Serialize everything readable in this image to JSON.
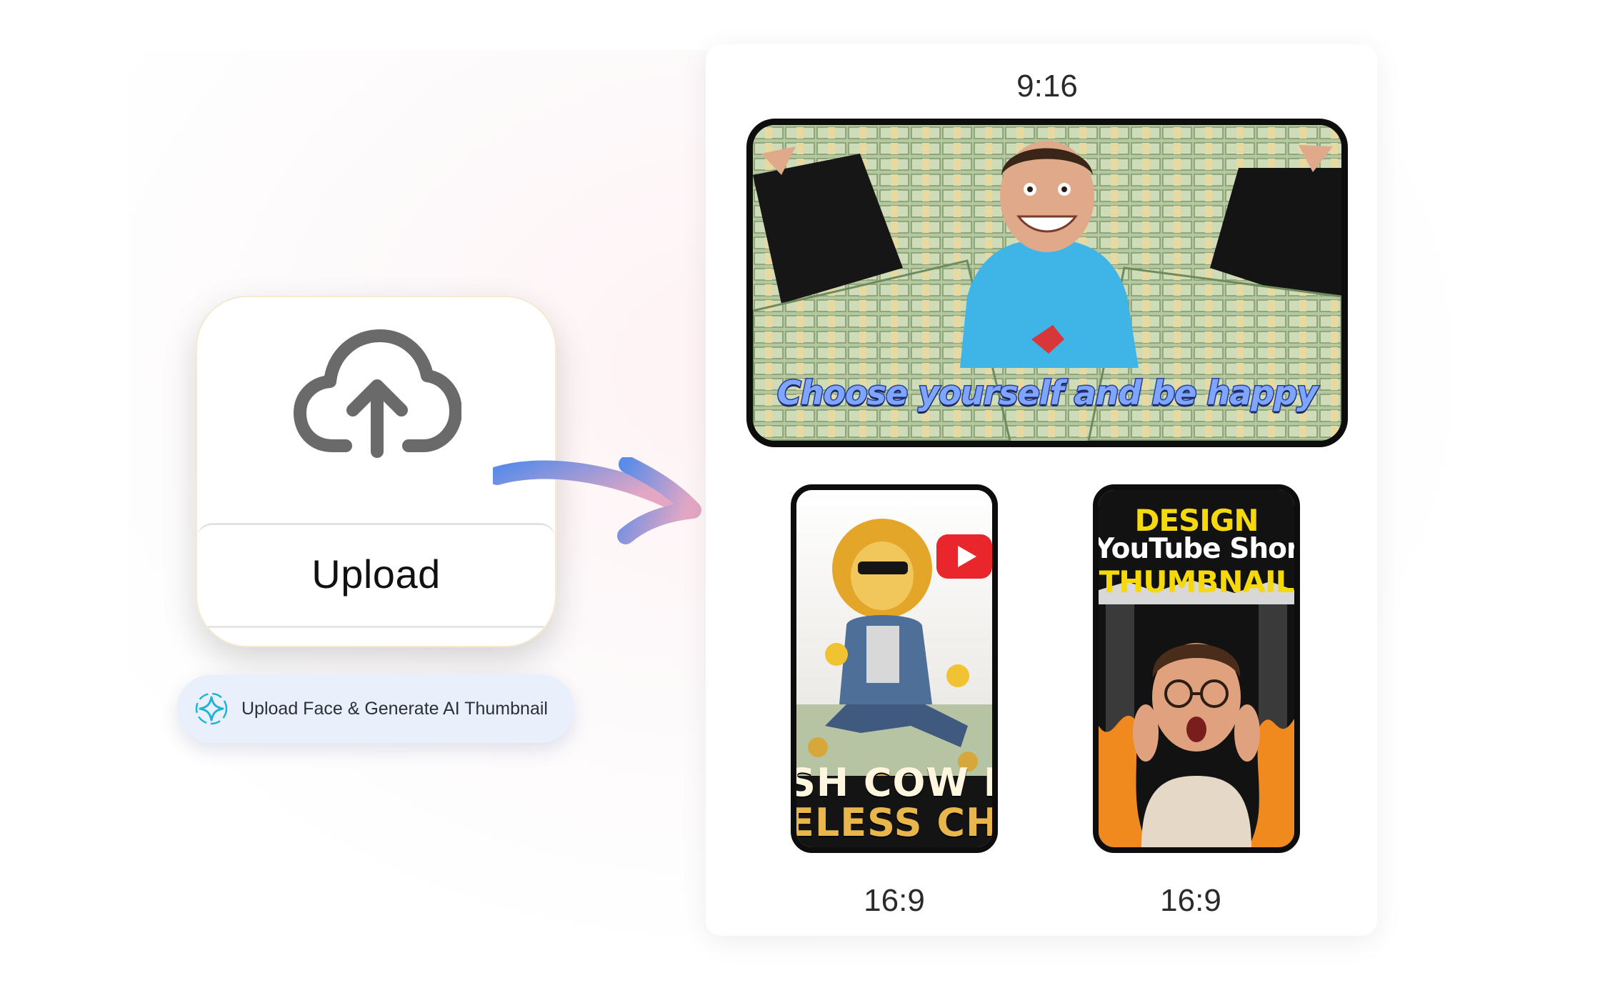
{
  "upload_card": {
    "icon": "cloud-upload-icon",
    "label": "Upload"
  },
  "generate_pill": {
    "icon": "sparkle-icon",
    "label": "Upload Face & Generate AI Thumbnail",
    "accent": "#1fb3d6"
  },
  "flow_arrow": {
    "icon": "curved-arrow-right-icon",
    "gradient": [
      "#5b8ce8",
      "#e3a7c4"
    ]
  },
  "results_panel": {
    "top_ratio": "9:16",
    "thumbnails": [
      {
        "name": "landscape-money",
        "caption": "Choose yourself and be happy"
      },
      {
        "name": "portrait-lion",
        "lines": [
          "SH COW DI",
          "ELESS CHAN"
        ],
        "ratio": "16:9"
      },
      {
        "name": "portrait-shorts",
        "lines": [
          "DESIGN",
          "YouTube Shorts",
          "THUMBNAIL"
        ],
        "ratio": "16:9"
      }
    ]
  }
}
